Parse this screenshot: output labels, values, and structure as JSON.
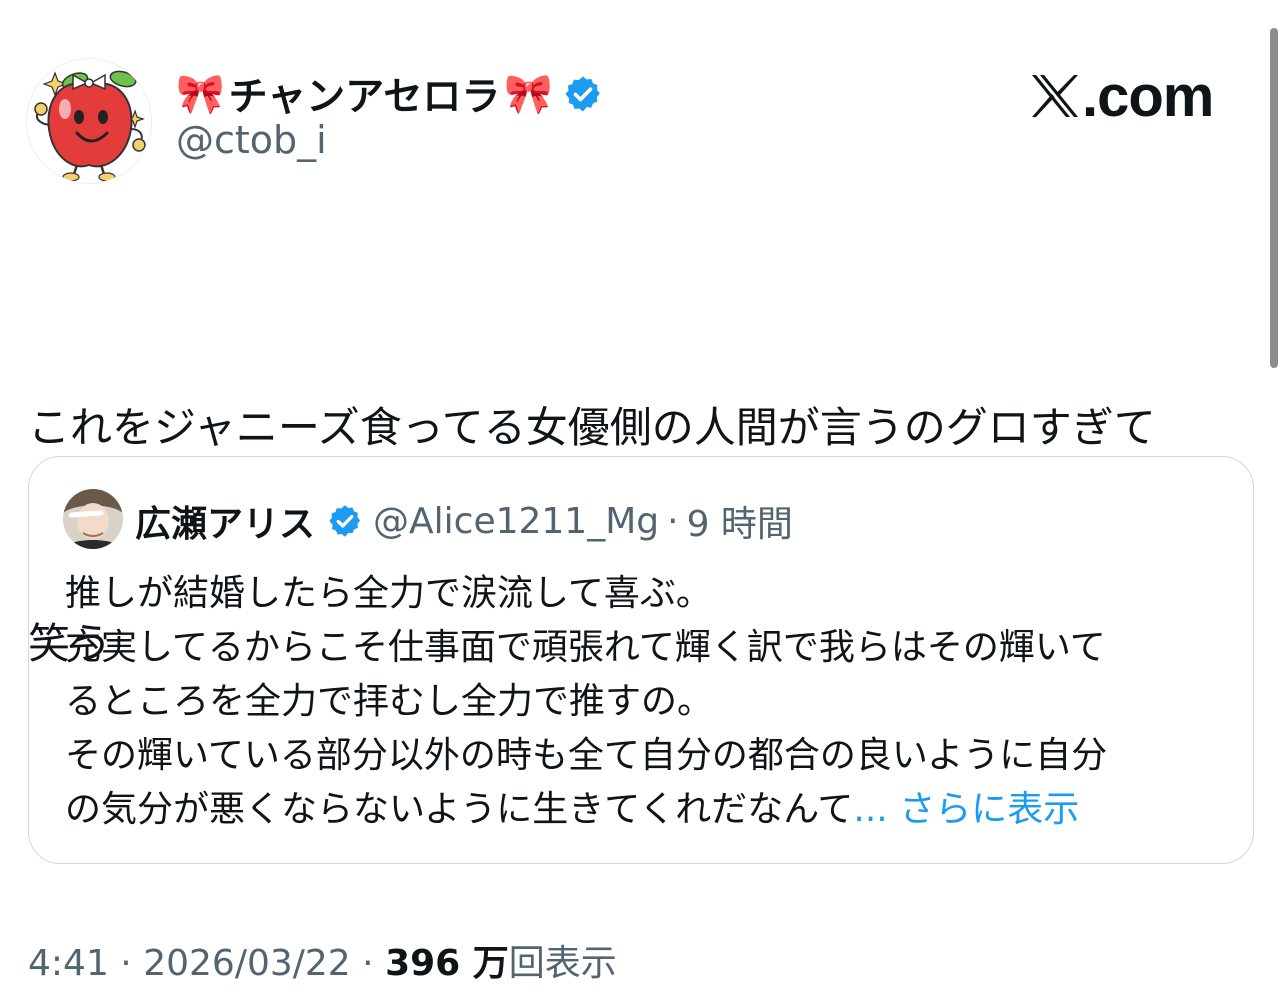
{
  "header": {
    "display_name_prefix_emoji": "🎀",
    "display_name": "チャンアセロラ",
    "display_name_suffix_emoji": "🎀",
    "handle": "@ctob_i",
    "site_label": ".com"
  },
  "tweet": {
    "text_line1": "これをジャニーズ食ってる女優側の人間が言うのグロすぎて",
    "text_line2": "笑う"
  },
  "quote": {
    "name": "広瀬アリス",
    "handle": "@Alice1211_Mg",
    "separator": "·",
    "time": "9 時間",
    "lines": [
      "推しが結婚したら全力で涙流して喜ぶ。",
      "充実してるからこそ仕事面で頑張れて輝く訳で我らはその輝いて",
      "るところを全力で拝むし全力で推すの。",
      "その輝いている部分以外の時も全て自分の都合の良いように自分",
      "の気分が悪くならないように生きてくれだなんて"
    ],
    "ellipsis": "...",
    "show_more": "さらに表示"
  },
  "footer": {
    "time": "4:41",
    "sep1": "·",
    "date": "2026/03/22",
    "sep2": "·",
    "views_count": "396 万",
    "views_label": "回表示"
  },
  "colors": {
    "verified_blue": "#1d9bf0",
    "link_blue": "#1d9bf0",
    "muted_text": "#536471",
    "primary_text": "#0f1419",
    "card_border": "#cfd9de"
  },
  "icons": {
    "verified": "verified-badge-icon",
    "x_logo": "x-logo-icon"
  }
}
